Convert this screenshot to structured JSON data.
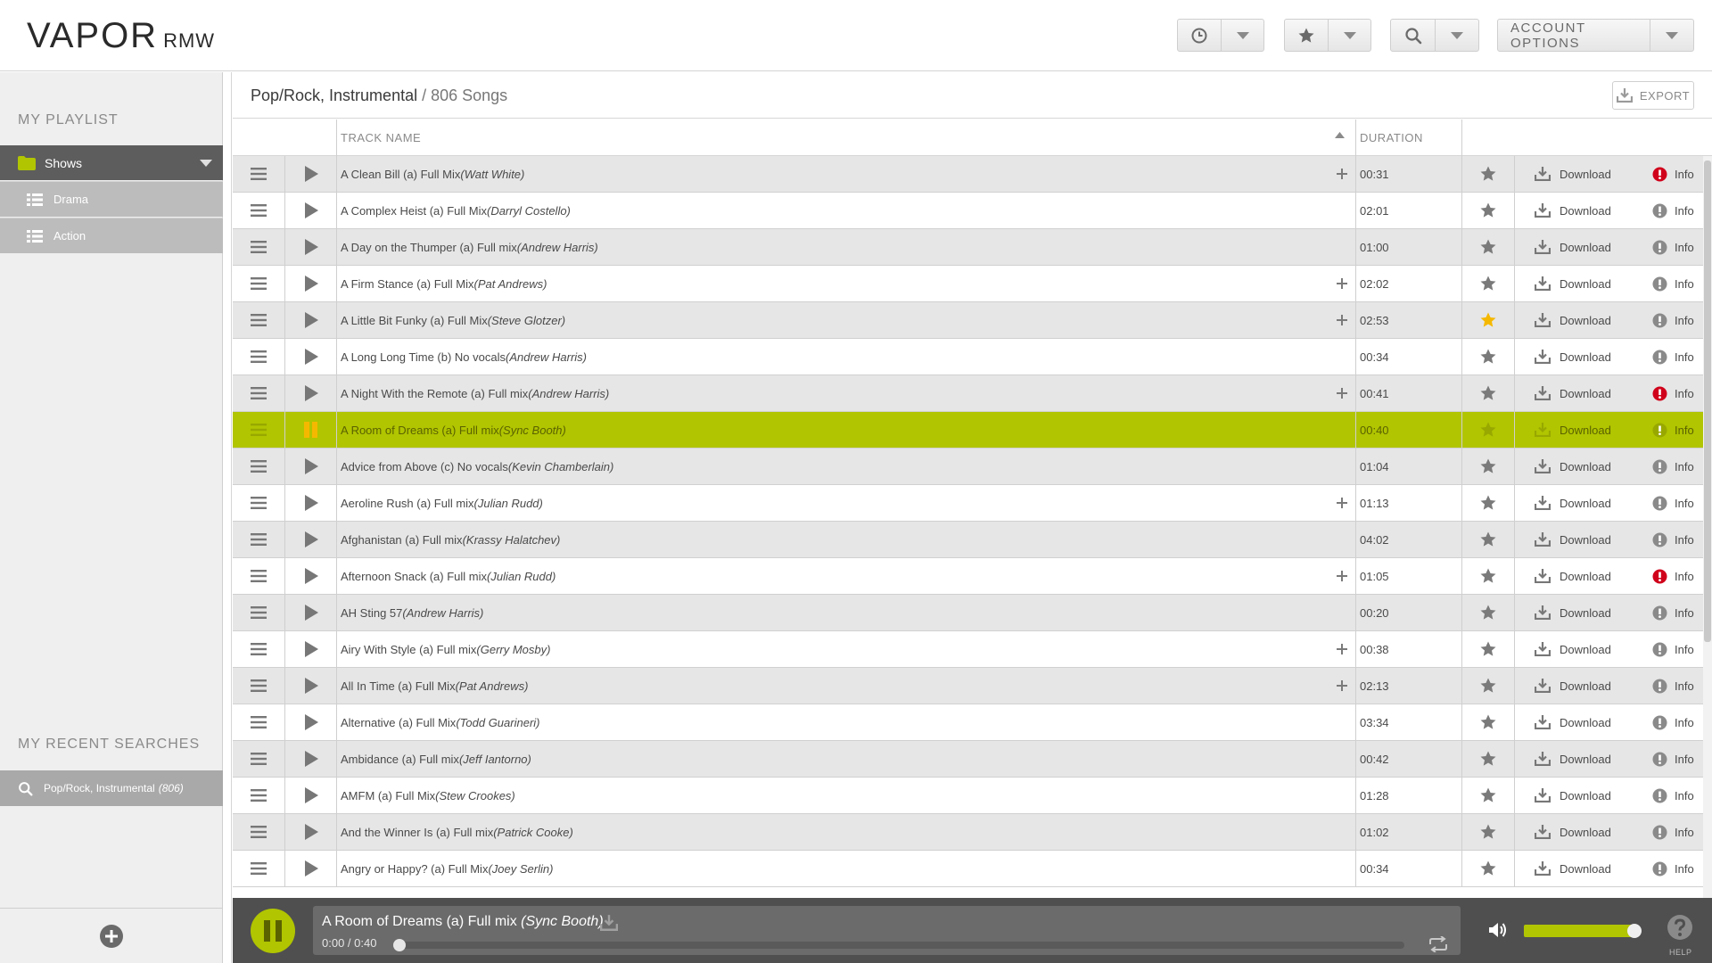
{
  "app": {
    "logo_main": "VAPOR",
    "logo_sub": "RMW"
  },
  "header": {
    "account_options_label": "ACCOUNT OPTIONS"
  },
  "sidebar": {
    "playlist_title": "MY PLAYLIST",
    "shows_label": "Shows",
    "sub_items": [
      {
        "label": "Drama"
      },
      {
        "label": "Action"
      }
    ],
    "recent_title": "MY RECENT SEARCHES",
    "recent_search": {
      "label": "Pop/Rock, Instrumental",
      "count": "(806)"
    }
  },
  "main": {
    "breadcrumb_category": "Pop/Rock, Instrumental",
    "breadcrumb_count": "/ 806 Songs",
    "export_label": "EXPORT",
    "columns": {
      "track_name": "TRACK NAME",
      "duration": "DURATION"
    },
    "download_label": "Download",
    "info_label": "Info",
    "tracks": [
      {
        "title": "A Clean Bill (a) Full Mix ",
        "artist": "(Watt White)",
        "duration": "00:31",
        "plus": true,
        "fav": false,
        "alert": true
      },
      {
        "title": "A Complex Heist (a) Full Mix ",
        "artist": "(Darryl Costello)",
        "duration": "02:01",
        "plus": false,
        "fav": false,
        "alert": false
      },
      {
        "title": "A Day on the Thumper (a) Full mix ",
        "artist": "(Andrew Harris)",
        "duration": "01:00",
        "plus": false,
        "fav": false,
        "alert": false
      },
      {
        "title": "A Firm Stance (a) Full Mix ",
        "artist": "(Pat Andrews)",
        "duration": "02:02",
        "plus": true,
        "fav": false,
        "alert": false
      },
      {
        "title": "A Little Bit Funky (a) Full Mix ",
        "artist": "(Steve Glotzer)",
        "duration": "02:53",
        "plus": true,
        "fav": true,
        "alert": false
      },
      {
        "title": "A Long Long Time (b) No vocals ",
        "artist": "(Andrew Harris)",
        "duration": "00:34",
        "plus": false,
        "fav": false,
        "alert": false
      },
      {
        "title": "A Night With the Remote (a) Full mix ",
        "artist": "(Andrew Harris)",
        "duration": "00:41",
        "plus": true,
        "fav": false,
        "alert": true
      },
      {
        "title": "A Room of Dreams (a) Full mix ",
        "artist": "(Sync Booth)",
        "duration": "00:40",
        "plus": false,
        "fav": false,
        "alert": false,
        "playing": true
      },
      {
        "title": "Advice from Above (c) No vocals ",
        "artist": "(Kevin Chamberlain)",
        "duration": "01:04",
        "plus": false,
        "fav": false,
        "alert": false
      },
      {
        "title": "Aeroline Rush (a) Full mix ",
        "artist": "(Julian Rudd)",
        "duration": "01:13",
        "plus": true,
        "fav": false,
        "alert": false
      },
      {
        "title": "Afghanistan (a) Full mix ",
        "artist": "(Krassy Halatchev)",
        "duration": "04:02",
        "plus": false,
        "fav": false,
        "alert": false
      },
      {
        "title": "Afternoon Snack (a) Full mix ",
        "artist": "(Julian Rudd)",
        "duration": "01:05",
        "plus": true,
        "fav": false,
        "alert": true
      },
      {
        "title": "AH Sting 57 ",
        "artist": "(Andrew Harris)",
        "duration": "00:20",
        "plus": false,
        "fav": false,
        "alert": false
      },
      {
        "title": "Airy With Style (a) Full mix ",
        "artist": "(Gerry Mosby)",
        "duration": "00:38",
        "plus": true,
        "fav": false,
        "alert": false
      },
      {
        "title": "All In Time (a) Full Mix ",
        "artist": "(Pat Andrews)",
        "duration": "02:13",
        "plus": true,
        "fav": false,
        "alert": false
      },
      {
        "title": "Alternative (a) Full Mix ",
        "artist": "(Todd Guarineri)",
        "duration": "03:34",
        "plus": false,
        "fav": false,
        "alert": false
      },
      {
        "title": "Ambidance (a) Full mix ",
        "artist": "(Jeff Iantorno)",
        "duration": "00:42",
        "plus": false,
        "fav": false,
        "alert": false
      },
      {
        "title": "AMFM (a) Full Mix ",
        "artist": "(Stew Crookes)",
        "duration": "01:28",
        "plus": false,
        "fav": false,
        "alert": false
      },
      {
        "title": "And the Winner Is (a) Full mix ",
        "artist": "(Patrick Cooke)",
        "duration": "01:02",
        "plus": false,
        "fav": false,
        "alert": false
      },
      {
        "title": "Angry or Happy? (a) Full Mix ",
        "artist": "(Joey Serlin)",
        "duration": "00:34",
        "plus": false,
        "fav": false,
        "alert": false
      }
    ]
  },
  "player": {
    "title": "A Room of Dreams (a) Full mix ",
    "artist": "(Sync Booth)",
    "time": "0:00 / 0:40",
    "progress": 0,
    "volume": 0.92,
    "help_label": "HELP"
  },
  "colors": {
    "accent": "#b1c500",
    "alert": "#d0021b",
    "favorite": "#f5b800",
    "folder": "#b1c500"
  },
  "icons": [
    "history-icon",
    "star-icon",
    "search-icon",
    "chevron-down-icon",
    "folder-icon",
    "list-icon",
    "menu-icon",
    "play-icon",
    "pause-icon",
    "plus-icon",
    "download-icon",
    "info-icon",
    "volume-icon",
    "repeat-icon",
    "help-icon",
    "add-circle-icon",
    "sort-up-icon"
  ]
}
